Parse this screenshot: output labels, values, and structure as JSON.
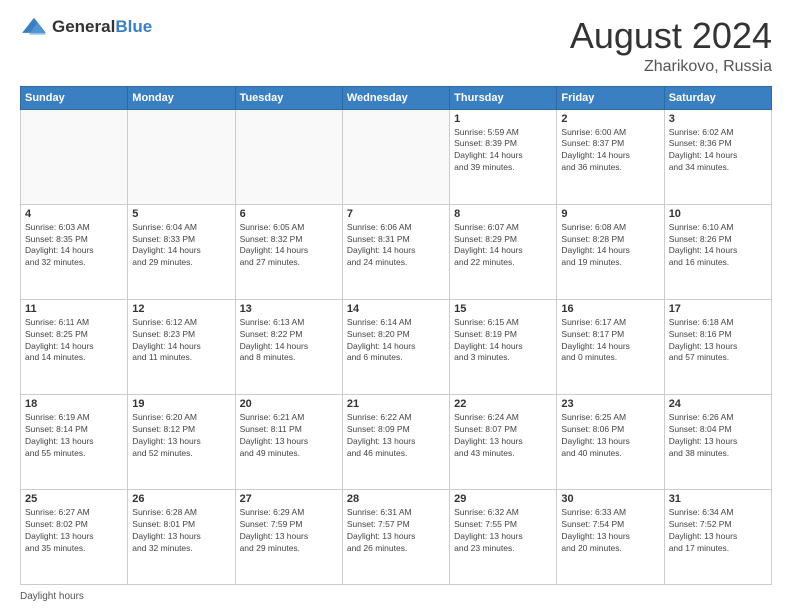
{
  "header": {
    "logo_general": "General",
    "logo_blue": "Blue",
    "month_year": "August 2024",
    "location": "Zharikovo, Russia"
  },
  "footer": {
    "daylight_label": "Daylight hours"
  },
  "days_of_week": [
    "Sunday",
    "Monday",
    "Tuesday",
    "Wednesday",
    "Thursday",
    "Friday",
    "Saturday"
  ],
  "weeks": [
    [
      {
        "day": "",
        "info": ""
      },
      {
        "day": "",
        "info": ""
      },
      {
        "day": "",
        "info": ""
      },
      {
        "day": "",
        "info": ""
      },
      {
        "day": "1",
        "info": "Sunrise: 5:59 AM\nSunset: 8:39 PM\nDaylight: 14 hours\nand 39 minutes."
      },
      {
        "day": "2",
        "info": "Sunrise: 6:00 AM\nSunset: 8:37 PM\nDaylight: 14 hours\nand 36 minutes."
      },
      {
        "day": "3",
        "info": "Sunrise: 6:02 AM\nSunset: 8:36 PM\nDaylight: 14 hours\nand 34 minutes."
      }
    ],
    [
      {
        "day": "4",
        "info": "Sunrise: 6:03 AM\nSunset: 8:35 PM\nDaylight: 14 hours\nand 32 minutes."
      },
      {
        "day": "5",
        "info": "Sunrise: 6:04 AM\nSunset: 8:33 PM\nDaylight: 14 hours\nand 29 minutes."
      },
      {
        "day": "6",
        "info": "Sunrise: 6:05 AM\nSunset: 8:32 PM\nDaylight: 14 hours\nand 27 minutes."
      },
      {
        "day": "7",
        "info": "Sunrise: 6:06 AM\nSunset: 8:31 PM\nDaylight: 14 hours\nand 24 minutes."
      },
      {
        "day": "8",
        "info": "Sunrise: 6:07 AM\nSunset: 8:29 PM\nDaylight: 14 hours\nand 22 minutes."
      },
      {
        "day": "9",
        "info": "Sunrise: 6:08 AM\nSunset: 8:28 PM\nDaylight: 14 hours\nand 19 minutes."
      },
      {
        "day": "10",
        "info": "Sunrise: 6:10 AM\nSunset: 8:26 PM\nDaylight: 14 hours\nand 16 minutes."
      }
    ],
    [
      {
        "day": "11",
        "info": "Sunrise: 6:11 AM\nSunset: 8:25 PM\nDaylight: 14 hours\nand 14 minutes."
      },
      {
        "day": "12",
        "info": "Sunrise: 6:12 AM\nSunset: 8:23 PM\nDaylight: 14 hours\nand 11 minutes."
      },
      {
        "day": "13",
        "info": "Sunrise: 6:13 AM\nSunset: 8:22 PM\nDaylight: 14 hours\nand 8 minutes."
      },
      {
        "day": "14",
        "info": "Sunrise: 6:14 AM\nSunset: 8:20 PM\nDaylight: 14 hours\nand 6 minutes."
      },
      {
        "day": "15",
        "info": "Sunrise: 6:15 AM\nSunset: 8:19 PM\nDaylight: 14 hours\nand 3 minutes."
      },
      {
        "day": "16",
        "info": "Sunrise: 6:17 AM\nSunset: 8:17 PM\nDaylight: 14 hours\nand 0 minutes."
      },
      {
        "day": "17",
        "info": "Sunrise: 6:18 AM\nSunset: 8:16 PM\nDaylight: 13 hours\nand 57 minutes."
      }
    ],
    [
      {
        "day": "18",
        "info": "Sunrise: 6:19 AM\nSunset: 8:14 PM\nDaylight: 13 hours\nand 55 minutes."
      },
      {
        "day": "19",
        "info": "Sunrise: 6:20 AM\nSunset: 8:12 PM\nDaylight: 13 hours\nand 52 minutes."
      },
      {
        "day": "20",
        "info": "Sunrise: 6:21 AM\nSunset: 8:11 PM\nDaylight: 13 hours\nand 49 minutes."
      },
      {
        "day": "21",
        "info": "Sunrise: 6:22 AM\nSunset: 8:09 PM\nDaylight: 13 hours\nand 46 minutes."
      },
      {
        "day": "22",
        "info": "Sunrise: 6:24 AM\nSunset: 8:07 PM\nDaylight: 13 hours\nand 43 minutes."
      },
      {
        "day": "23",
        "info": "Sunrise: 6:25 AM\nSunset: 8:06 PM\nDaylight: 13 hours\nand 40 minutes."
      },
      {
        "day": "24",
        "info": "Sunrise: 6:26 AM\nSunset: 8:04 PM\nDaylight: 13 hours\nand 38 minutes."
      }
    ],
    [
      {
        "day": "25",
        "info": "Sunrise: 6:27 AM\nSunset: 8:02 PM\nDaylight: 13 hours\nand 35 minutes."
      },
      {
        "day": "26",
        "info": "Sunrise: 6:28 AM\nSunset: 8:01 PM\nDaylight: 13 hours\nand 32 minutes."
      },
      {
        "day": "27",
        "info": "Sunrise: 6:29 AM\nSunset: 7:59 PM\nDaylight: 13 hours\nand 29 minutes."
      },
      {
        "day": "28",
        "info": "Sunrise: 6:31 AM\nSunset: 7:57 PM\nDaylight: 13 hours\nand 26 minutes."
      },
      {
        "day": "29",
        "info": "Sunrise: 6:32 AM\nSunset: 7:55 PM\nDaylight: 13 hours\nand 23 minutes."
      },
      {
        "day": "30",
        "info": "Sunrise: 6:33 AM\nSunset: 7:54 PM\nDaylight: 13 hours\nand 20 minutes."
      },
      {
        "day": "31",
        "info": "Sunrise: 6:34 AM\nSunset: 7:52 PM\nDaylight: 13 hours\nand 17 minutes."
      }
    ]
  ]
}
